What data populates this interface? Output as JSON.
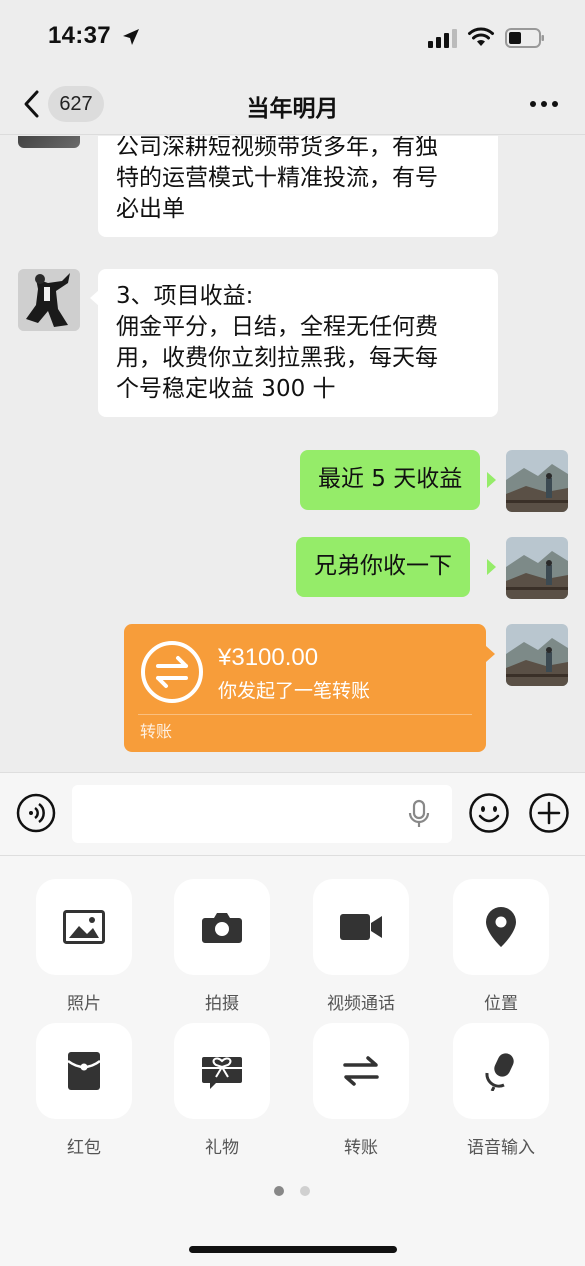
{
  "status_bar": {
    "time": "14:37"
  },
  "nav": {
    "badge": "627",
    "title": "当年明月"
  },
  "messages": [
    {
      "side": "left",
      "text_lines": [
        "公司深耕短视频带货多年，有独",
        "特的运营模式十精准投流，有号",
        "必出单"
      ]
    },
    {
      "side": "left",
      "text_lines": [
        "3、项目收益:",
        "佣金平分，日结，全程无任何费",
        "用，收费你立刻拉黑我，每天每",
        "个号稳定收益 300 十"
      ]
    },
    {
      "side": "right",
      "text": "最近 5 天收益"
    },
    {
      "side": "right",
      "text": "兄弟你收一下"
    }
  ],
  "transfer": {
    "amount": "¥3100.00",
    "description": "你发起了一笔转账",
    "label": "转账"
  },
  "tools": [
    {
      "label": "照片",
      "icon": "photo-icon"
    },
    {
      "label": "拍摄",
      "icon": "camera-icon"
    },
    {
      "label": "视频通话",
      "icon": "video-call-icon"
    },
    {
      "label": "位置",
      "icon": "location-icon"
    },
    {
      "label": "红包",
      "icon": "red-packet-icon"
    },
    {
      "label": "礼物",
      "icon": "gift-icon"
    },
    {
      "label": "转账",
      "icon": "transfer-icon"
    },
    {
      "label": "语音输入",
      "icon": "voice-input-icon"
    }
  ],
  "colors": {
    "green_bubble": "#95ec69",
    "transfer_orange": "#f79d3a",
    "background": "#ededed"
  }
}
